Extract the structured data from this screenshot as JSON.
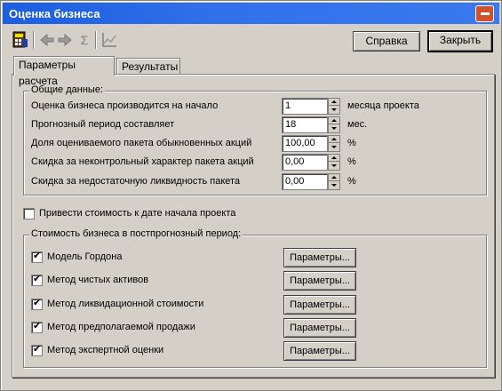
{
  "window": {
    "title": "Оценка бизнеса"
  },
  "toolbar": {
    "icons": [
      "calculator-icon",
      "forward-icon",
      "back-icon",
      "sigma-icon",
      "chart-icon"
    ],
    "sigma": "Σ"
  },
  "buttons": {
    "help": "Справка",
    "close": "Закрыть"
  },
  "tabs": [
    {
      "label": "Параметры расчета",
      "active": true
    },
    {
      "label": "Результаты",
      "active": false
    }
  ],
  "general": {
    "title": "Общие данные:",
    "rows": [
      {
        "label": "Оценка бизнеса производится на начало",
        "value": "1",
        "unit": "месяца проекта"
      },
      {
        "label": "Прогнозный период составляет",
        "value": "18",
        "unit": "мес."
      },
      {
        "label": "Доля оцениваемого пакета обыкновенных акций",
        "value": "100,00",
        "unit": "%"
      },
      {
        "label": "Скидка за неконтрольный характер пакета акций",
        "value": "0,00",
        "unit": "%"
      },
      {
        "label": "Скидка за недостаточную ликвидность пакета",
        "value": "0,00",
        "unit": "%"
      }
    ]
  },
  "adjust": {
    "label": "Привести стоимость к дате начала проекта",
    "checked": false
  },
  "postforecast": {
    "title": "Стоимость бизнеса в постпрогнозный период:",
    "methods": [
      {
        "label": "Модель Гордона",
        "checked": true,
        "button": "Параметры..."
      },
      {
        "label": "Метод чистых активов",
        "checked": true,
        "button": "Параметры..."
      },
      {
        "label": "Метод ликвидационной стоимости",
        "checked": true,
        "button": "Параметры..."
      },
      {
        "label": "Метод предполагаемой продажи",
        "checked": true,
        "button": "Параметры..."
      },
      {
        "label": "Метод экспертной оценки",
        "checked": true,
        "button": "Параметры..."
      }
    ]
  }
}
